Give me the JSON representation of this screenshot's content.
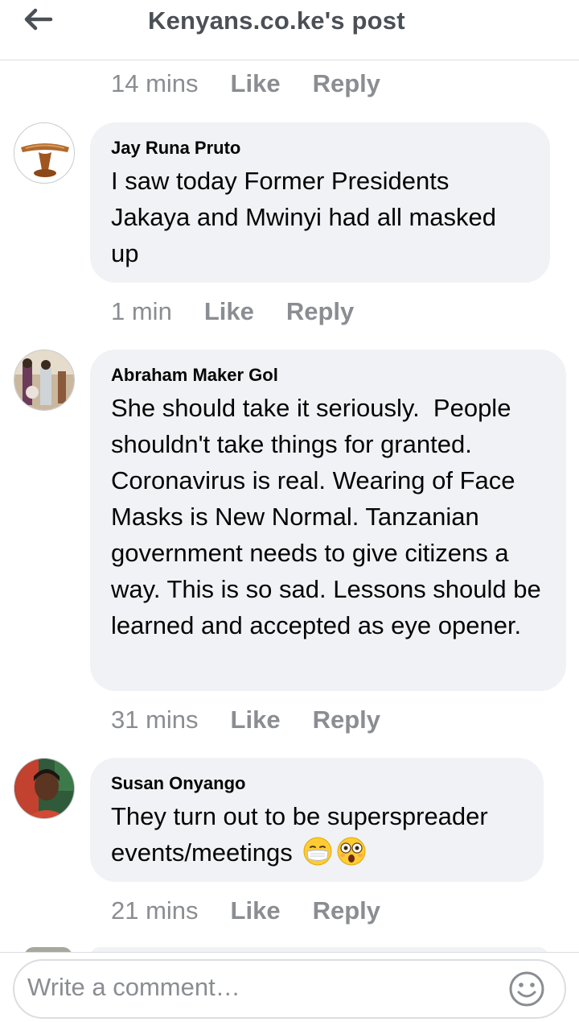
{
  "header": {
    "title": "Kenyans.co.ke's post",
    "back_icon": "arrow-left-icon"
  },
  "top_actions": {
    "time": "14 mins",
    "like": "Like",
    "reply": "Reply"
  },
  "comments": [
    {
      "author": "Jay Runa Pruto",
      "text": "I saw today Former Presidents Jakaya and Mwinyi had all masked up",
      "time": "1 min",
      "like": "Like",
      "reply": "Reply"
    },
    {
      "author": "Abraham Maker Gol",
      "text": "She should take it seriously.  People shouldn't take things for granted. Coronavirus is real. Wearing of Face Masks is New Normal. Tanzanian government needs to give citizens a way. This is so sad. Lessons should be learned and accepted as eye opener.",
      "time": "31 mins",
      "like": "Like",
      "reply": "Reply"
    },
    {
      "author": "Susan Onyango",
      "text": "They turn out to be superspreader events/meetings",
      "emojis": [
        "face-with-medical-mask-icon",
        "flushed-face-icon"
      ],
      "time": "21 mins",
      "like": "Like",
      "reply": "Reply"
    }
  ],
  "composer": {
    "placeholder": "Write a comment…",
    "emoji_icon": "smiley-icon"
  },
  "colors": {
    "bubble": "#f0f2f5",
    "meta_text": "#8a8d91",
    "header_text": "#4b4f56"
  }
}
